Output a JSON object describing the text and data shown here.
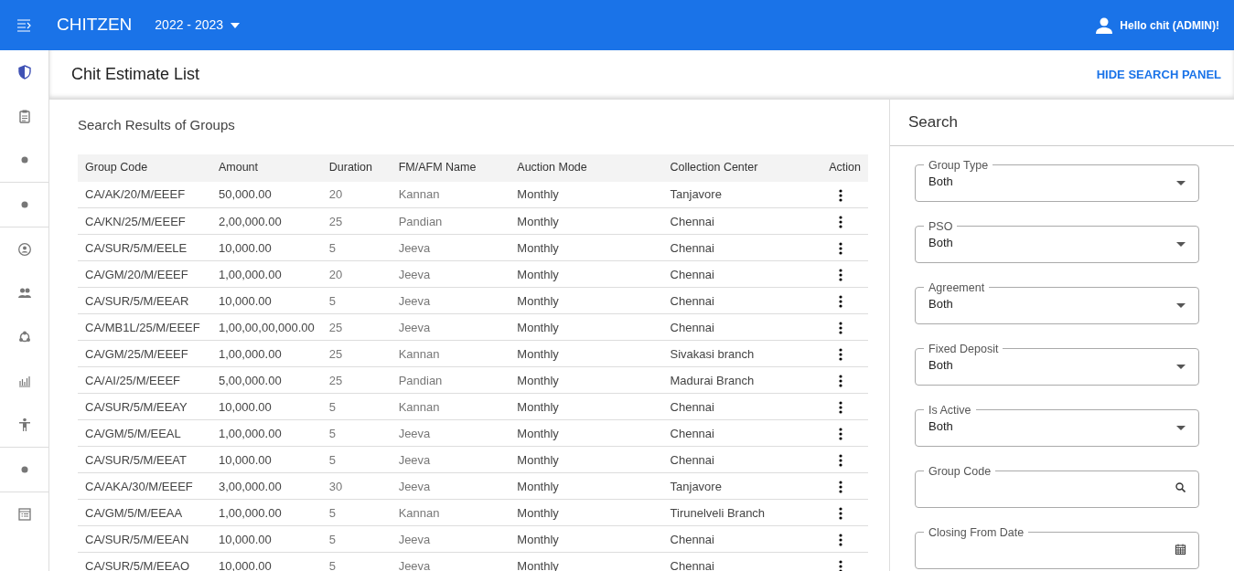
{
  "app_bar": {
    "brand": "CHITZEN",
    "year": "2022 - 2023",
    "user": "Hello chit (ADMIN)!"
  },
  "page": {
    "title": "Chit Estimate List",
    "toggle": "HIDE SEARCH PANEL"
  },
  "results": {
    "title": "Search Results of Groups",
    "columns": [
      "Group Code",
      "Amount",
      "Duration",
      "FM/AFM Name",
      "Auction Mode",
      "Collection Center",
      "Action"
    ],
    "rows": [
      [
        "CA/AK/20/M/EEEF",
        "50,000.00",
        "20",
        "Kannan",
        "Monthly",
        "Tanjavore"
      ],
      [
        "CA/KN/25/M/EEEF",
        "2,00,000.00",
        "25",
        "Pandian",
        "Monthly",
        "Chennai"
      ],
      [
        "CA/SUR/5/M/EELE",
        "10,000.00",
        "5",
        "Jeeva",
        "Monthly",
        "Chennai"
      ],
      [
        "CA/GM/20/M/EEEF",
        "1,00,000.00",
        "20",
        "Jeeva",
        "Monthly",
        "Chennai"
      ],
      [
        "CA/SUR/5/M/EEAR",
        "10,000.00",
        "5",
        "Jeeva",
        "Monthly",
        "Chennai"
      ],
      [
        "CA/MB1L/25/M/EEEF",
        "1,00,00,00,000.00",
        "25",
        "Jeeva",
        "Monthly",
        "Chennai"
      ],
      [
        "CA/GM/25/M/EEEF",
        "1,00,000.00",
        "25",
        "Kannan",
        "Monthly",
        "Sivakasi branch"
      ],
      [
        "CA/AI/25/M/EEEF",
        "5,00,000.00",
        "25",
        "Pandian",
        "Monthly",
        "Madurai Branch"
      ],
      [
        "CA/SUR/5/M/EEAY",
        "10,000.00",
        "5",
        "Kannan",
        "Monthly",
        "Chennai"
      ],
      [
        "CA/GM/5/M/EEAL",
        "1,00,000.00",
        "5",
        "Jeeva",
        "Monthly",
        "Chennai"
      ],
      [
        "CA/SUR/5/M/EEAT",
        "10,000.00",
        "5",
        "Jeeva",
        "Monthly",
        "Chennai"
      ],
      [
        "CA/AKA/30/M/EEEF",
        "3,00,000.00",
        "30",
        "Jeeva",
        "Monthly",
        "Tanjavore"
      ],
      [
        "CA/GM/5/M/EEAA",
        "1,00,000.00",
        "5",
        "Kannan",
        "Monthly",
        "Tirunelveli Branch"
      ],
      [
        "CA/SUR/5/M/EEAN",
        "10,000.00",
        "5",
        "Jeeva",
        "Monthly",
        "Chennai"
      ],
      [
        "CA/SUR/5/M/EEAO",
        "10,000.00",
        "5",
        "Jeeva",
        "Monthly",
        "Chennai"
      ]
    ]
  },
  "search_panel": {
    "title": "Search",
    "fields": [
      {
        "kind": "select",
        "label": "Group Type",
        "value": "Both"
      },
      {
        "kind": "select",
        "label": "PSO",
        "value": "Both"
      },
      {
        "kind": "select",
        "label": "Agreement",
        "value": "Both"
      },
      {
        "kind": "select",
        "label": "Fixed Deposit",
        "value": "Both"
      },
      {
        "kind": "select",
        "label": "Is Active",
        "value": "Both"
      },
      {
        "kind": "search",
        "label": "Group Code"
      },
      {
        "kind": "date",
        "label": "Closing From Date"
      }
    ]
  }
}
